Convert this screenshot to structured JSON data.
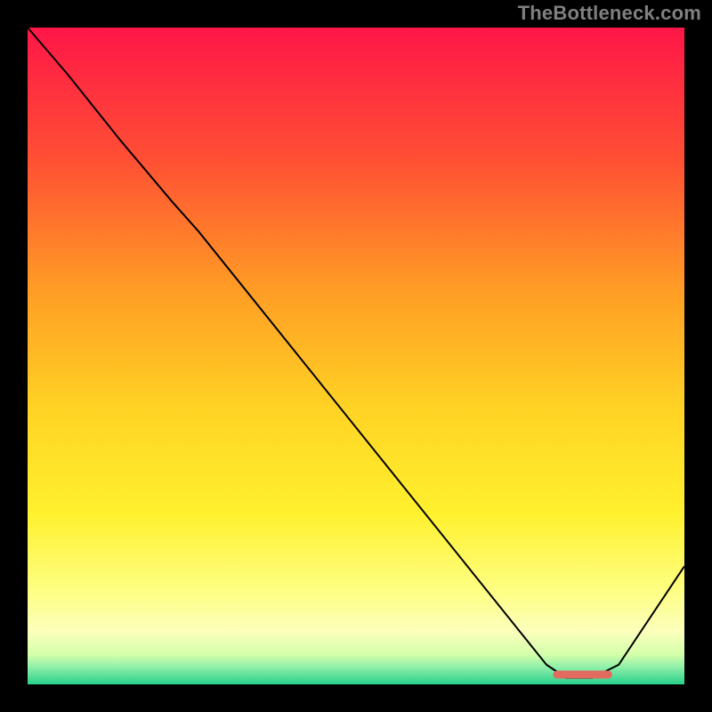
{
  "watermark": "TheBottleneck.com",
  "chart_data": {
    "type": "line",
    "title": "",
    "xlabel": "",
    "ylabel": "",
    "xlim": [
      0,
      100
    ],
    "ylim": [
      0,
      100
    ],
    "grid": false,
    "legend": false,
    "background": {
      "type": "vertical-gradient",
      "stops": [
        {
          "pos": 0.0,
          "color": "#ff1648"
        },
        {
          "pos": 0.2,
          "color": "#ff4f34"
        },
        {
          "pos": 0.4,
          "color": "#ff9d25"
        },
        {
          "pos": 0.58,
          "color": "#ffd324"
        },
        {
          "pos": 0.74,
          "color": "#fff12e"
        },
        {
          "pos": 0.86,
          "color": "#feff85"
        },
        {
          "pos": 0.92,
          "color": "#fbffbc"
        },
        {
          "pos": 0.955,
          "color": "#d3ffaa"
        },
        {
          "pos": 0.975,
          "color": "#8aeea8"
        },
        {
          "pos": 1.0,
          "color": "#26d08a"
        }
      ]
    },
    "series": [
      {
        "name": "bottleneck-curve",
        "color": "#000000",
        "width": 2,
        "x": [
          0.0,
          6.0,
          14.0,
          22.0,
          26.0,
          79.0,
          82.0,
          86.0,
          90.0,
          100.0
        ],
        "y": [
          100.0,
          93.0,
          83.0,
          73.5,
          69.0,
          3.0,
          1.0,
          1.0,
          3.0,
          18.0
        ]
      }
    ],
    "marker": {
      "name": "optimal-range",
      "color": "#e36a5e",
      "x_start": 80.0,
      "x_end": 89.0,
      "y": 1.5,
      "thickness": 1.2
    }
  }
}
